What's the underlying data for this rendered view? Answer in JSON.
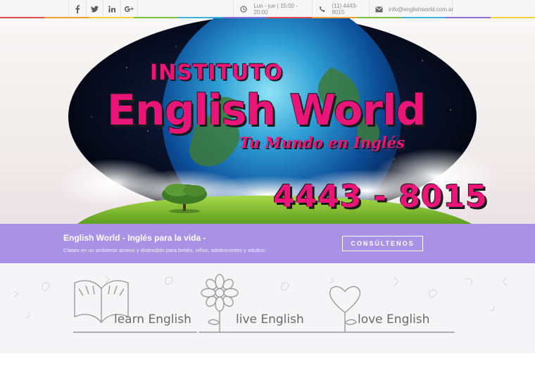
{
  "topbar": {
    "social": [
      {
        "name": "facebook-icon",
        "glyph": "f"
      },
      {
        "name": "twitter-icon",
        "glyph": "t"
      },
      {
        "name": "linkedin-icon",
        "glyph": "in"
      },
      {
        "name": "google-plus-icon",
        "glyph": "g+"
      }
    ],
    "hours": "Lun - jue | 15:00 - 20:00",
    "phone": "(11) 4443-8015",
    "email": "info@englishworld.com.ar",
    "stripe_colors": [
      "#e54b4b",
      "#f0a030",
      "#f3d23a",
      "#7ac143",
      "#3bb3d9",
      "#8e6fd8",
      "#e54b4b",
      "#f0a030",
      "#7ac143",
      "#3bb3d9",
      "#8e6fd8",
      "#f3d23a"
    ]
  },
  "hero": {
    "line1": "INSTITUTO",
    "line2": "English World",
    "line3": "Tu Mundo en Inglés",
    "phone": "4443 - 8015",
    "pink": "#ea1578"
  },
  "band": {
    "title": "English World - Inglés para la vida -",
    "subtitle": "Clases en un ambiente ameno y distendido para bebés, niños, adolescentes y adultos.",
    "cta": "CONSÚLTENOS",
    "color": "#a991e6"
  },
  "doodles": {
    "learn": "learn English",
    "live": "live English",
    "love": "love English"
  }
}
